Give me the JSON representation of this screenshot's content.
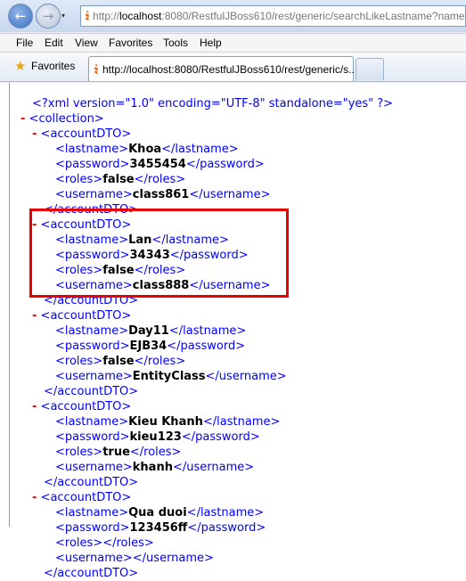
{
  "browser": {
    "address": {
      "url_gray_prefix": "http://",
      "url_host": "localhost",
      "url_rest": ":8080/RestfulJBoss610/rest/generic/searchLikeLastname?name=a"
    },
    "menu": [
      "File",
      "Edit",
      "View",
      "Favorites",
      "Tools",
      "Help"
    ],
    "favorites_label": "Favorites",
    "tab_title": "http://localhost:8080/RestfulJBoss610/rest/generic/s..."
  },
  "xml": {
    "declaration": "<?xml version=\"1.0\" encoding=\"UTF-8\" standalone=\"yes\" ?>",
    "collapse_symbol": "-",
    "root_open": "<collection>",
    "item_open": "<accountDTO>",
    "item_close": "</accountDTO>",
    "tags": {
      "lastname_open": "<lastname>",
      "lastname_close": "</lastname>",
      "password_open": "<password>",
      "password_close": "</password>",
      "roles_open": "<roles>",
      "roles_close": "</roles>",
      "username_open": "<username>",
      "username_close": "</username>"
    },
    "accounts": [
      {
        "lastname": "Khoa",
        "password": "3455454",
        "roles": "false",
        "username": "class861"
      },
      {
        "lastname": "Lan",
        "password": "34343",
        "roles": "false",
        "username": "class888"
      },
      {
        "lastname": "Day11",
        "password": "EJB34",
        "roles": "false",
        "username": "EntityClass"
      },
      {
        "lastname": "Kieu Khanh",
        "password": "kieu123",
        "roles": "true",
        "username": "khanh"
      },
      {
        "lastname": "Qua duoi",
        "password": "123456ff",
        "roles": "",
        "username": ""
      }
    ]
  },
  "colors": {
    "tag": "#0000ff",
    "value": "#000000",
    "highlight": "#e60000",
    "minus": "#ff0000"
  }
}
